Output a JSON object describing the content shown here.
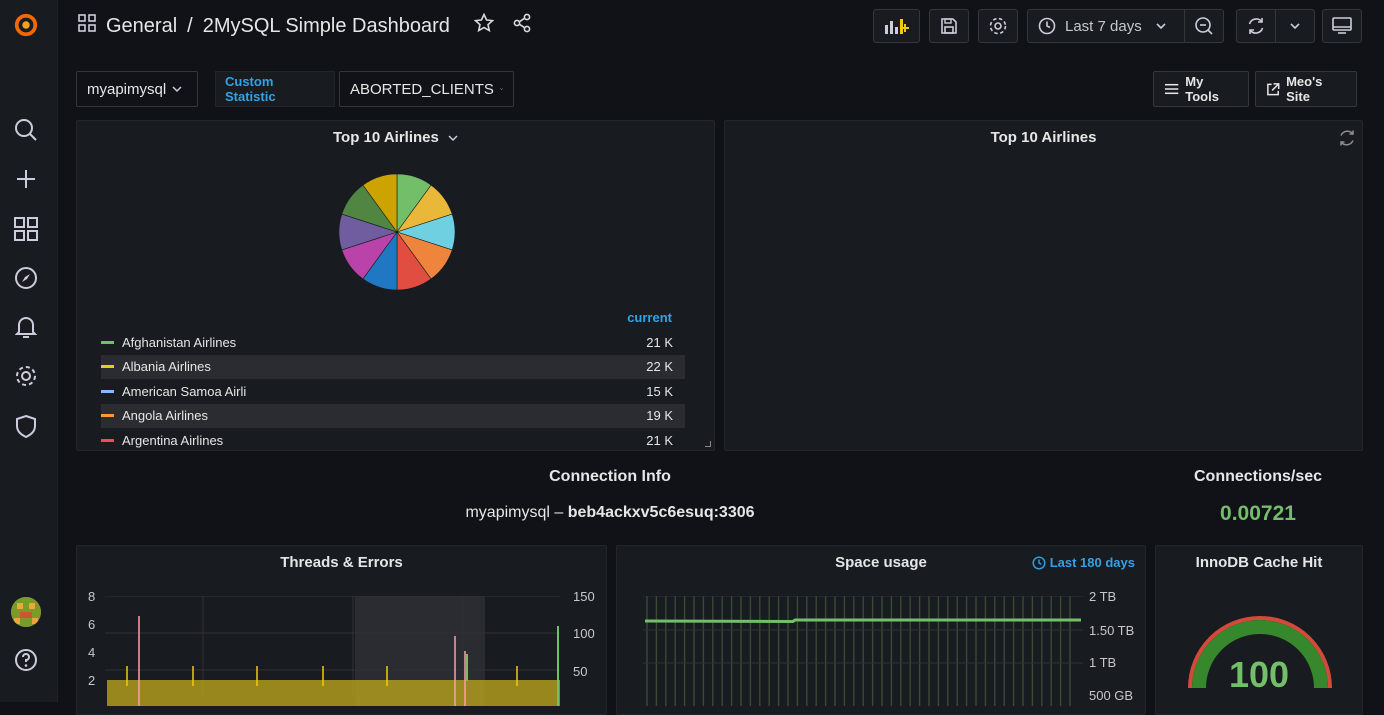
{
  "breadcrumb": {
    "folder": "General",
    "separator": "/",
    "dashboard": "2MySQL Simple Dashboard"
  },
  "toolbar": {
    "time_range": "Last 7 days"
  },
  "variables": {
    "instance": "myapimysql",
    "custom_label": "Custom Statistic",
    "custom_value": "ABORTED_CLIENTS"
  },
  "links": {
    "tools": "My Tools",
    "site": "Meo's Site"
  },
  "pie_panel": {
    "title": "Top 10 Airlines",
    "legend_header": "current",
    "legend": [
      {
        "name": "Afghanistan Airlines",
        "value": "21 K",
        "color": "#73bf69"
      },
      {
        "name": "Albania Airlines",
        "value": "22 K",
        "color": "#f2cc0c"
      },
      {
        "name": "American Samoa Airli",
        "value": "15 K",
        "color": "#8ab8ff"
      },
      {
        "name": "Angola Airlines",
        "value": "19 K",
        "color": "#ff9830"
      },
      {
        "name": "Argentina Airlines",
        "value": "21 K",
        "color": "#f2495c"
      }
    ]
  },
  "chart_data": [
    {
      "type": "pie",
      "title": "Top 10 Airlines",
      "categories": [
        "Afghanistan Airlines",
        "Albania Airlines",
        "American Samoa Airli",
        "Angola Airlines",
        "Argentina Airlines"
      ],
      "values": [
        21000,
        22000,
        15000,
        19000,
        21000
      ]
    },
    {
      "type": "bar",
      "title": "Threads & Errors",
      "y_left_ticks": [
        "8",
        "6",
        "4",
        "2"
      ],
      "y_right_ticks": [
        "150",
        "100",
        "50"
      ]
    },
    {
      "type": "line",
      "title": "Space usage",
      "y_ticks": [
        "2 TB",
        "1.50 TB",
        "1 TB",
        "500 GB"
      ]
    }
  ],
  "pie_slice_colors": [
    "#73bf69",
    "#eab839",
    "#6ed0e0",
    "#ef843c",
    "#e24d42",
    "#1f78c1",
    "#ba43a9",
    "#705da0",
    "#508642",
    "#cca300"
  ],
  "table_panel": {
    "title": "Top 10 Airlines"
  },
  "conn_info": {
    "title": "Connection Info",
    "host_prefix": "myapimysql – ",
    "host": "beb4ackxv5c6esuq:3306"
  },
  "conn_sec": {
    "title": "Connections/sec",
    "value": "0.00721"
  },
  "threads_panel": {
    "title": "Threads & Errors",
    "y_left": [
      "8",
      "6",
      "4",
      "2"
    ],
    "y_right": [
      "150",
      "100",
      "50"
    ]
  },
  "space_panel": {
    "title": "Space usage",
    "time_override": "Last 180 days",
    "y_right": [
      "2 TB",
      "1.50 TB",
      "1 TB",
      "500 GB"
    ]
  },
  "innodb_panel": {
    "title": "InnoDB Cache Hit",
    "value": "100",
    "value_color": "#73bf69"
  }
}
